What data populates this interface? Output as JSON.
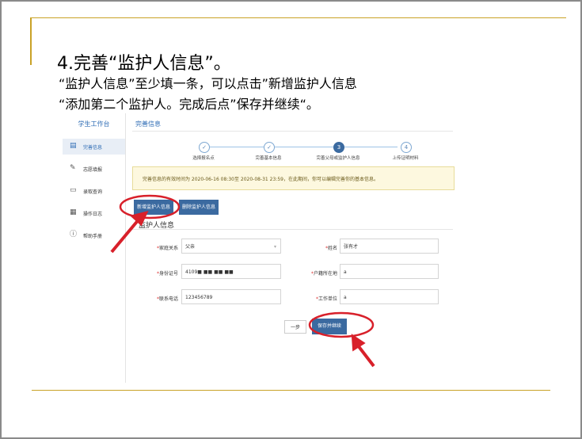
{
  "slide": {
    "title": "4.完善“监护人信息”。",
    "line1": "“监护人信息”至少填一条，可以点击”新增监护人信息",
    "line2": "“添加第二个监护人。完成后点”保存并继续“。"
  },
  "sidebar": {
    "title": "学生工作台",
    "items": [
      {
        "label": "完善信息",
        "icon": "form-icon",
        "active": true
      },
      {
        "label": "志愿填报",
        "icon": "edit-icon",
        "active": false
      },
      {
        "label": "录取查询",
        "icon": "document-icon",
        "active": false
      },
      {
        "label": "操作日志",
        "icon": "calendar-icon",
        "active": false
      },
      {
        "label": "帮助手册",
        "icon": "info-icon",
        "active": false
      }
    ]
  },
  "main": {
    "page_title": "完善信息",
    "steps": [
      {
        "num": "✓",
        "label": "选择报名点"
      },
      {
        "num": "✓",
        "label": "完善基本信息"
      },
      {
        "num": "3",
        "label": "完善父母或监护人信息"
      },
      {
        "num": "4",
        "label": "上传证明材料"
      }
    ],
    "notice": "完善信息的有效时间为 2020-06-16 08:30至 2020-08-31 23:59，在此期间，你可以编辑完善你的基本信息。",
    "add_button": "新增监护人信息",
    "delete_button": "删除监护人信息",
    "section_title": "监护人信息",
    "form": {
      "relation_label": "家庭关系",
      "relation_value": "父亲",
      "name_label": "姓名",
      "name_value": "张有才",
      "id_label": "身份证号",
      "id_value": "4109■ ■■ ■■ ■■",
      "hukou_label": "户籍所在地",
      "hukou_value": "a",
      "phone_label": "联系电话",
      "phone_value": "123456789",
      "work_label": "工作单位",
      "work_value": "a"
    },
    "prev_button": "一步",
    "save_button": "保存并继续"
  },
  "colors": {
    "accent": "#3b6aa0",
    "highlight": "#d8202a",
    "gold": "#c9a227"
  }
}
